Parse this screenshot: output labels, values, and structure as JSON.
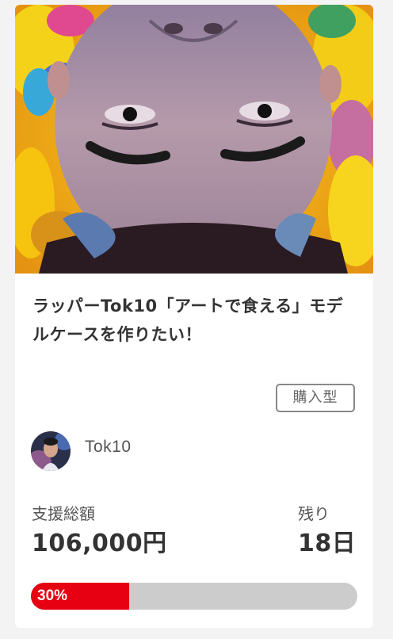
{
  "project": {
    "title": "ラッパーTok10「アートで食える」モデルケースを作りたい！",
    "type_badge": "購入型",
    "author_name": "Tok10",
    "total_label": "支援総額",
    "total_value": "106,000円",
    "remaining_label": "残り",
    "remaining_value": "18日",
    "progress_text": "30%",
    "progress_fraction": 0.3
  },
  "colors": {
    "accent": "#e60012",
    "progress_track": "#cccccc",
    "card_background": "#ffffff",
    "page_background": "#f3f3f3"
  }
}
